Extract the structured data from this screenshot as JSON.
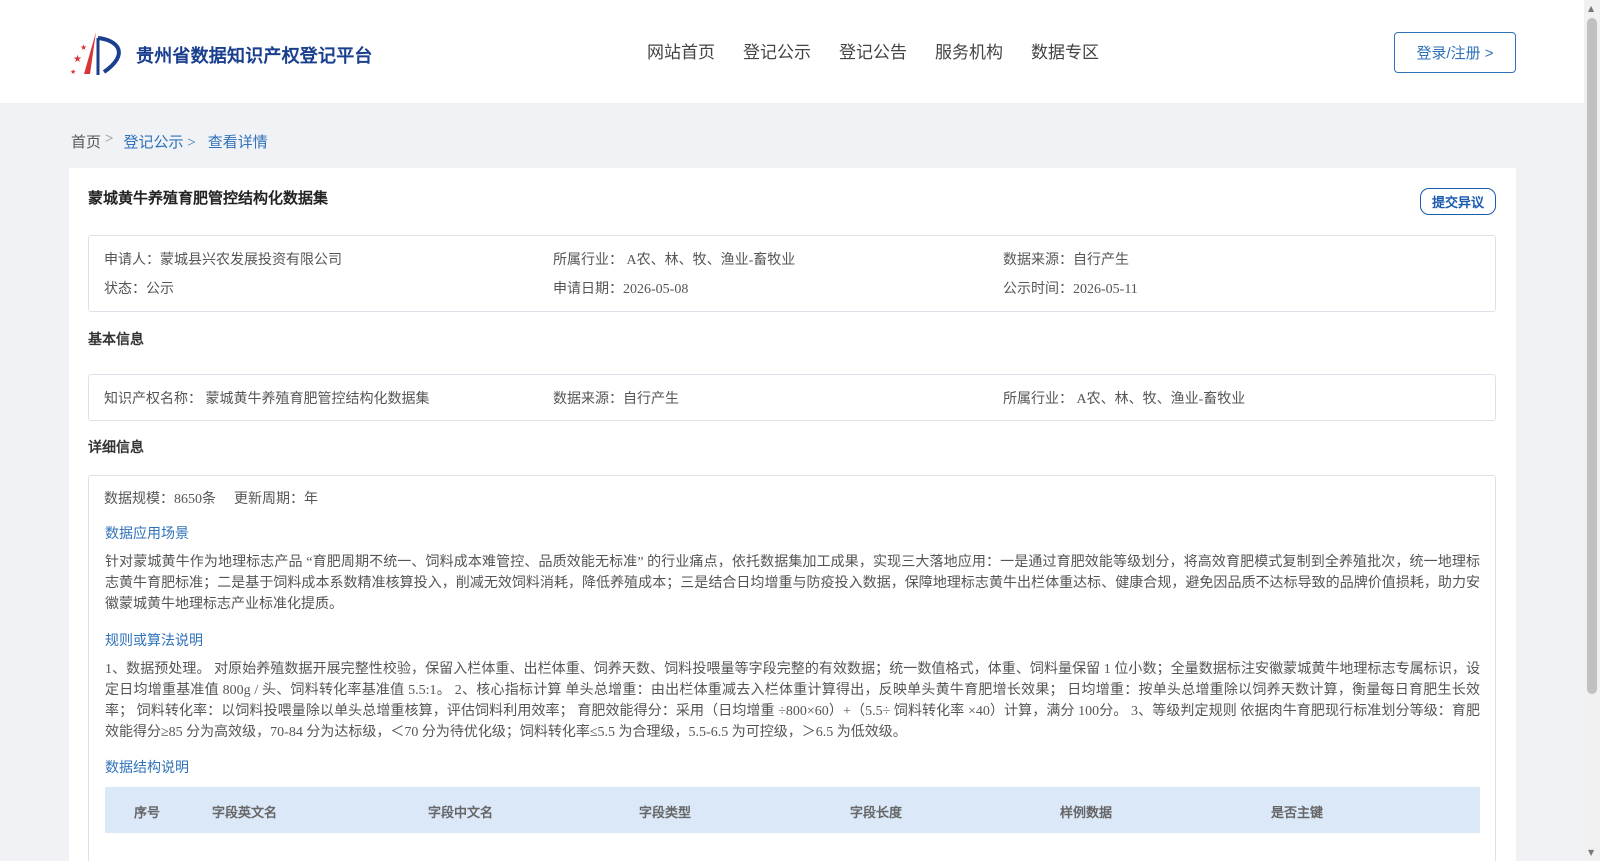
{
  "header": {
    "site_name": "贵州省数据知识产权登记平台",
    "nav": [
      "网站首页",
      "登记公示",
      "登记公告",
      "服务机构",
      "数据专区"
    ],
    "login_label": "登录/注册 >"
  },
  "breadcrumb": {
    "home": "首页",
    "sep": ">",
    "items": [
      "登记公示 >",
      "查看详情"
    ]
  },
  "detail": {
    "title": "蒙城黄牛养殖育肥管控结构化数据集",
    "objection_label": "提交异议",
    "summary": {
      "applicant": "申请人：蒙城县兴农发展投资有限公司",
      "industry": "所属行业： A农、林、牧、渔业-畜牧业",
      "source": "数据来源：自行产生",
      "status": "状态：公示",
      "apply_date": "申请日期：2026-05-08",
      "publish_time": "公示时间：2026-05-11"
    },
    "basic": {
      "section_title": "基本信息",
      "ip_name": "知识产权名称： 蒙城黄牛养殖育肥管控结构化数据集",
      "source": "数据来源：自行产生",
      "industry": "所属行业： A农、林、牧、渔业-畜牧业"
    },
    "details": {
      "section_title": "详细信息",
      "scale": "数据规模：8650条",
      "update_cycle": "更新周期：年",
      "scenario_title": "数据应用场景",
      "scenario_text": "针对蒙城黄牛作为地理标志产品 “育肥周期不统一、饲料成本难管控、品质效能无标准” 的行业痛点，依托数据集加工成果，实现三大落地应用：一是通过育肥效能等级划分，将高效育肥模式复制到全养殖批次，统一地理标志黄牛育肥标准；二是基于饲料成本系数精准核算投入，削减无效饲料消耗，降低养殖成本；三是结合日均增重与防疫投入数据，保障地理标志黄牛出栏体重达标、健康合规，避免因品质不达标导致的品牌价值损耗，助力安徽蒙城黄牛地理标志产业标准化提质。",
      "rules_title": "规则或算法说明",
      "rules_text": "1、数据预处理。 对原始养殖数据开展完整性校验，保留入栏体重、出栏体重、饲养天数、饲料投喂量等字段完整的有效数据；统一数值格式，体重、饲料量保留 1 位小数；全量数据标注安徽蒙城黄牛地理标志专属标识，设定日均增重基准值 800g / 头、饲料转化率基准值 5.5:1。 2、核心指标计算 单头总增重：由出栏体重减去入栏体重计算得出，反映单头黄牛育肥增长效果； 日均增重：按单头总增重除以饲养天数计算，衡量每日育肥生长效率； 饲料转化率：以饲料投喂量除以单头总增重核算，评估饲料利用效率； 育肥效能得分：采用（日均增重 ÷800×60）+（5.5÷ 饲料转化率 ×40）计算，满分 100分。 3、等级判定规则 依据肉牛育肥现行标准划分等级：育肥效能得分≥85 分为高效级，70-84 分为达标级，＜70 分为待优化级；饲料转化率≤5.5 为合理级，5.5-6.5 为可控级，＞6.5 为低效级。",
      "structure_title": "数据结构说明",
      "table_headers": [
        "序号",
        "字段英文名",
        "字段中文名",
        "字段类型",
        "字段长度",
        "样例数据",
        "是否主键"
      ]
    }
  },
  "colors": {
    "brand": "#1a3f8f",
    "link": "#2f72b9",
    "table_head_bg": "#dbe8f8"
  }
}
